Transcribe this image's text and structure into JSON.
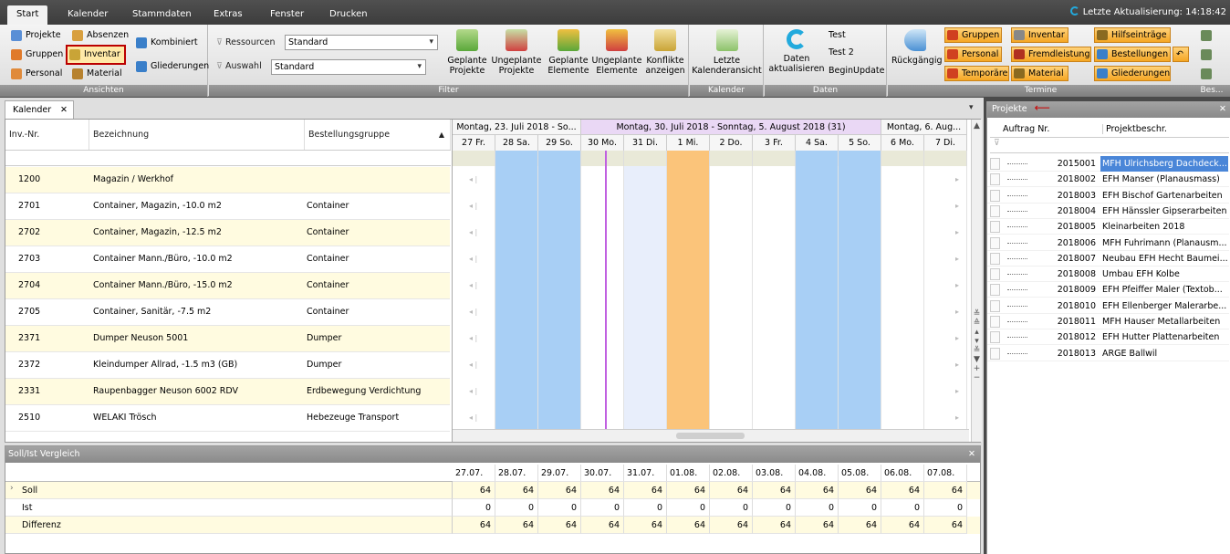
{
  "menu": {
    "tabs": [
      "Start",
      "Kalender",
      "Stammdaten",
      "Extras",
      "Fenster",
      "Drucken"
    ],
    "last_update": "Letzte Aktualisierung: 14:18:42"
  },
  "ribbon": {
    "ansichten": {
      "label": "Ansichten",
      "projekte": "Projekte",
      "absenzen": "Absenzen",
      "kombiniert": "Kombiniert",
      "gruppen": "Gruppen",
      "inventar": "Inventar",
      "gliederungen": "Gliederungen",
      "personal": "Personal",
      "material": "Material"
    },
    "filter": {
      "label": "Filter",
      "ressourcen_label": "Ressourcen",
      "ressourcen_value": "Standard",
      "auswahl_label": "Auswahl",
      "auswahl_value": "Standard",
      "geplante_projekte": "Geplante Projekte",
      "ungeplante_projekte": "Ungeplante Projekte",
      "geplante_elemente": "Geplante Elemente",
      "ungeplante_elemente": "Ungeplante Elemente",
      "konflikte": "Konflikte anzeigen"
    },
    "kalender": {
      "label": "Kalender",
      "letzte": "Letzte Kalenderansicht"
    },
    "daten": {
      "label": "Daten",
      "aktualisieren": "Daten aktualisieren",
      "test": "Test",
      "test2": "Test 2",
      "beginupdate": "BeginUpdate"
    },
    "termine": {
      "label": "Termine",
      "rueckgaengig": "Rückgängig",
      "gruppen": "Gruppen",
      "inventar": "Inventar",
      "hilfseintraege": "Hilfseinträge",
      "personal": "Personal",
      "fremdleistung": "Fremdleistung",
      "bestellungen": "Bestellungen",
      "temporaere": "Temporäre",
      "material": "Material",
      "gliederungen": "Gliederungen",
      "bes_label": "Bes..."
    }
  },
  "calendar_tab": "Kalender",
  "grid": {
    "headers": [
      "Inv.-Nr.",
      "Bezeichnung",
      "Bestellungsgruppe"
    ],
    "rows": [
      {
        "nr": "1200",
        "bez": "Magazin / Werkhof",
        "gruppe": ""
      },
      {
        "nr": "2701",
        "bez": "Container, Magazin, -10.0 m2",
        "gruppe": "Container"
      },
      {
        "nr": "2702",
        "bez": "Container, Magazin, -12.5 m2",
        "gruppe": "Container"
      },
      {
        "nr": "2703",
        "bez": "Container Mann./Büro,  -10.0 m2",
        "gruppe": "Container"
      },
      {
        "nr": "2704",
        "bez": "Container Mann./Büro,  -15.0 m2",
        "gruppe": "Container"
      },
      {
        "nr": "2705",
        "bez": "Container, Sanitär,   -7.5 m2",
        "gruppe": "Container"
      },
      {
        "nr": "2371",
        "bez": "Dumper Neuson 5001",
        "gruppe": "Dumper"
      },
      {
        "nr": "2372",
        "bez": "Kleindumper Allrad, -1.5 m3 (GB)",
        "gruppe": "Dumper"
      },
      {
        "nr": "2331",
        "bez": "Raupenbagger Neuson 6002 RDV",
        "gruppe": "Erdbewegung Verdichtung"
      },
      {
        "nr": "2510",
        "bez": "WELAKI Trösch",
        "gruppe": "Hebezeuge Transport"
      }
    ]
  },
  "calendar": {
    "weeks": [
      "Montag, 23. Juli 2018 - So...",
      "Montag, 30. Juli 2018 - Sonntag, 5. August 2018 (31)",
      "Montag, 6. Aug..."
    ],
    "days": [
      "27 Fr.",
      "28 Sa.",
      "29 So.",
      "30 Mo.",
      "31 Di.",
      "1 Mi.",
      "2 Do.",
      "3 Fr.",
      "4 Sa.",
      "5 So.",
      "6 Mo.",
      "7 Di."
    ],
    "colors": {
      "weekend": "#a8cff5",
      "today": "#fbc47a",
      "week_highlight": "#ead8f5",
      "marker": "#c060e0"
    }
  },
  "soll": {
    "title": "Soll/Ist Vergleich",
    "dates": [
      "27.07.",
      "28.07.",
      "29.07.",
      "30.07.",
      "31.07.",
      "01.08.",
      "02.08.",
      "03.08.",
      "04.08.",
      "05.08.",
      "06.08.",
      "07.08."
    ],
    "rows": [
      {
        "label": "Soll",
        "values": [
          "64",
          "64",
          "64",
          "64",
          "64",
          "64",
          "64",
          "64",
          "64",
          "64",
          "64",
          "64"
        ]
      },
      {
        "label": "Ist",
        "values": [
          "0",
          "0",
          "0",
          "0",
          "0",
          "0",
          "0",
          "0",
          "0",
          "0",
          "0",
          "0"
        ]
      },
      {
        "label": "Differenz",
        "values": [
          "64",
          "64",
          "64",
          "64",
          "64",
          "64",
          "64",
          "64",
          "64",
          "64",
          "64",
          "64"
        ]
      }
    ]
  },
  "projekte": {
    "title": "Projekte",
    "headers": [
      "Auftrag Nr.",
      "Projektbeschr."
    ],
    "rows": [
      {
        "nr": "2015001",
        "desc": "MFH Ulrichsberg Dachdeck..."
      },
      {
        "nr": "2018002",
        "desc": "EFH Manser (Planausmass)"
      },
      {
        "nr": "2018003",
        "desc": "EFH Bischof Gartenarbeiten"
      },
      {
        "nr": "2018004",
        "desc": "EFH Hänssler Gipserarbeiten"
      },
      {
        "nr": "2018005",
        "desc": "Kleinarbeiten 2018"
      },
      {
        "nr": "2018006",
        "desc": "MFH Fuhrimann (Planausm..."
      },
      {
        "nr": "2018007",
        "desc": "Neubau EFH Hecht Baumei..."
      },
      {
        "nr": "2018008",
        "desc": "Umbau EFH Kolbe"
      },
      {
        "nr": "2018009",
        "desc": "EFH Pfeiffer Maler (Textob..."
      },
      {
        "nr": "2018010",
        "desc": "EFH Ellenberger Malerarbe..."
      },
      {
        "nr": "2018011",
        "desc": "MFH Hauser Metallarbeiten"
      },
      {
        "nr": "2018012",
        "desc": "EFH Hutter Plattenarbeiten"
      },
      {
        "nr": "2018013",
        "desc": "ARGE Ballwil"
      }
    ]
  }
}
